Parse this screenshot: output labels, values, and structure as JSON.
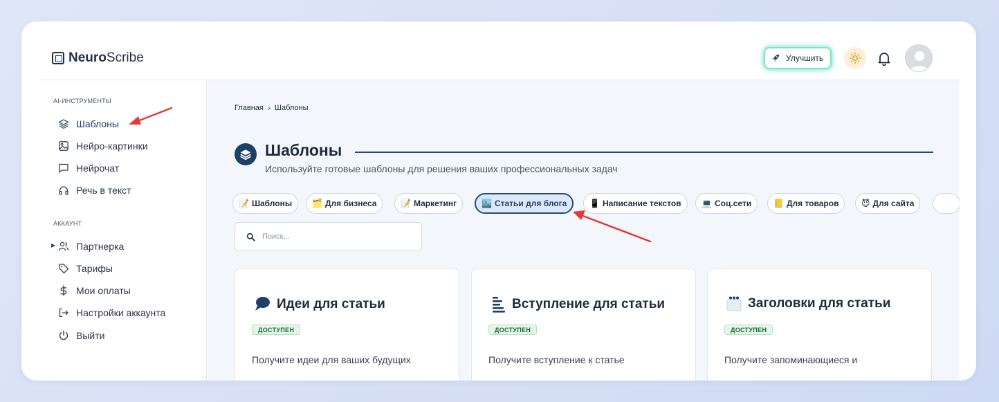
{
  "header": {
    "logo_bold": "Neuro",
    "logo_light": "Scribe",
    "upgrade_label": "Улучшить"
  },
  "sidebar": {
    "section_tools": "AI-ИНСТРУМЕНТЫ",
    "tools": [
      {
        "label": "Шаблоны",
        "icon": "layers-icon"
      },
      {
        "label": "Нейро-картинки",
        "icon": "image-icon"
      },
      {
        "label": "Нейрочат",
        "icon": "chat-icon"
      },
      {
        "label": "Речь в текст",
        "icon": "headphones-icon"
      }
    ],
    "section_account": "АККАУНТ",
    "account": [
      {
        "label": "Партнерка",
        "icon": "users-icon"
      },
      {
        "label": "Тарифы",
        "icon": "tag-icon"
      },
      {
        "label": "Мои оплаты",
        "icon": "dollar-icon"
      },
      {
        "label": "Настройки аккаунта",
        "icon": "logout-arrow-icon"
      },
      {
        "label": "Выйти",
        "icon": "power-icon"
      }
    ]
  },
  "main": {
    "breadcrumb": [
      "Главная",
      "Шаблоны"
    ],
    "title": "Шаблоны",
    "subtitle": "Используйте готовые шаблоны для решения ваших профессиональных задач",
    "chips": [
      {
        "label": "Шаблоны",
        "emoji": "📝"
      },
      {
        "label": "Для бизнеса",
        "emoji": "🗂️"
      },
      {
        "label": "Маркетинг",
        "emoji": "📝"
      },
      {
        "label": "Статьи для блога",
        "emoji": "🏙️"
      },
      {
        "label": "Написание текстов",
        "emoji": "📱"
      },
      {
        "label": "Соц.сети",
        "emoji": "💻"
      },
      {
        "label": "Для товаров",
        "emoji": "📒"
      },
      {
        "label": "Для сайта",
        "emoji": "😈"
      }
    ],
    "search_placeholder": "Поиск...",
    "cards": [
      {
        "title": "Идеи для статьи",
        "badge": "ДОСТУПЕН",
        "desc": "Получите идеи для ваших будущих",
        "icon": "speech-bubble-icon"
      },
      {
        "title": "Вступление для статьи",
        "badge": "ДОСТУПЕН",
        "desc": "Получите вступление к статье",
        "icon": "text-lines-icon"
      },
      {
        "title": "Заголовки для статьи",
        "badge": "ДОСТУПЕН",
        "desc": "Получите запоминающиеся и",
        "icon": "dots-window-icon"
      }
    ]
  },
  "colors": {
    "accent": "#21406a",
    "badge_bg": "#e3f6e8",
    "annotation_arrow": "#e53935"
  }
}
